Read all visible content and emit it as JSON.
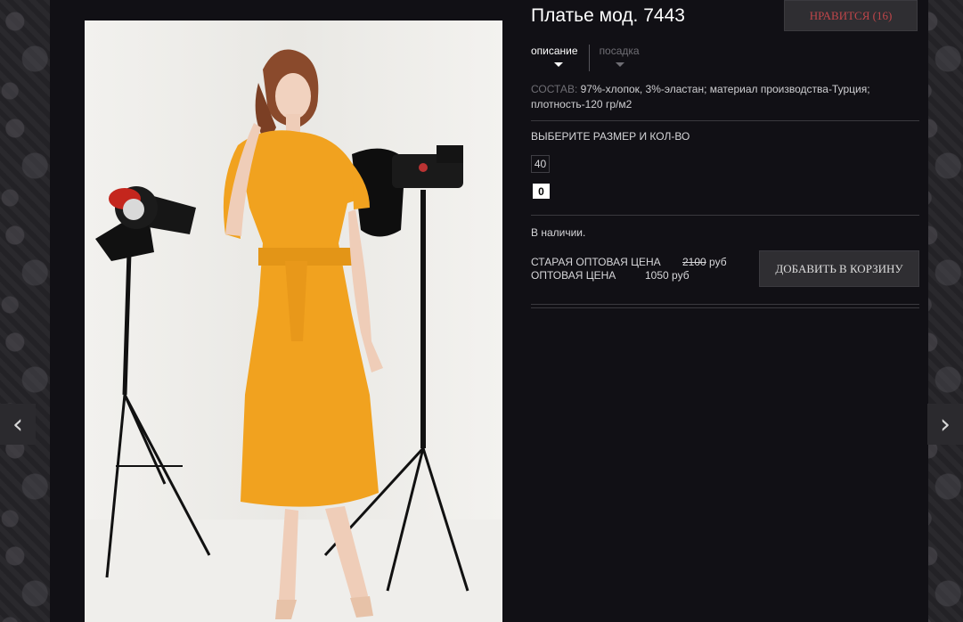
{
  "product": {
    "title": "Платье мод. 7443",
    "like_label": "НРАВИТСЯ (16)"
  },
  "tabs": [
    {
      "label": "описание",
      "active": true
    },
    {
      "label": "посадка",
      "active": false
    }
  ],
  "composition": {
    "label": "СОСТАВ:",
    "text": "97%-хлопок, 3%-эластан; материал производства-Турция; плотность-120 гр/м2"
  },
  "size": {
    "heading": "ВЫБЕРИТЕ РАЗМЕР И КОЛ-ВО",
    "value": "40",
    "quantity": "0"
  },
  "availability": "В наличии.",
  "prices": {
    "old_label": "СТАРАЯ ОПТОВАЯ ЦЕНА",
    "old_value": "2100",
    "old_unit": "руб",
    "current_label": "ОПТОВАЯ ЦЕНА",
    "current_value": "1050 руб"
  },
  "add_to_cart_label": "ДОБАВИТЬ В КОРЗИНУ",
  "icons": {
    "prev": "chevron-left-icon",
    "next": "chevron-right-icon"
  },
  "colors": {
    "background": "#111015",
    "like_text": "#c0464a",
    "dress": "#f1a21f"
  }
}
